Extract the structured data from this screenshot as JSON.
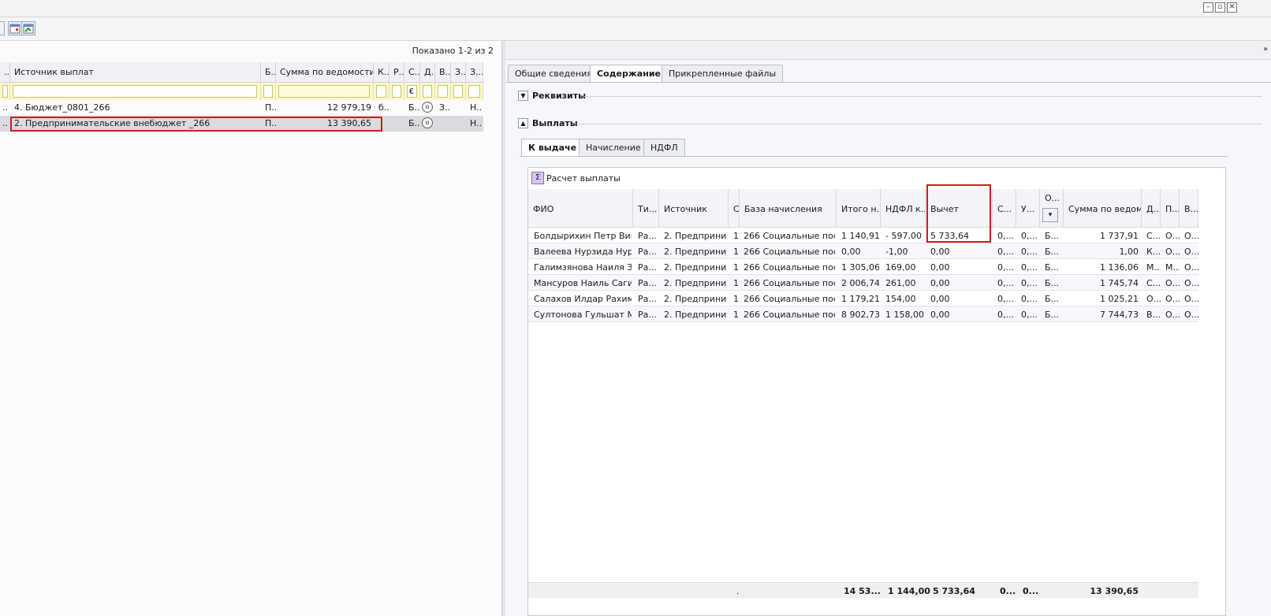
{
  "window": {
    "min_glyph": "–",
    "restore_glyph": "▫",
    "close_glyph": "✕"
  },
  "left": {
    "shown_text": "Показано 1-2 из 2",
    "columns": [
      "..",
      "Источник выплат",
      "Б...",
      "Сумма по ведомости",
      "К...",
      "Р...",
      "С...",
      "Д...",
      "В...",
      "З...",
      "З..."
    ],
    "filter_values": [
      "",
      "",
      "",
      "",
      "",
      "",
      "€",
      "",
      "",
      "",
      ""
    ],
    "rows": [
      {
        "c0": "..",
        "source": "4. Бюджет_0801_266",
        "b": "П...",
        "sum": "12 979,19",
        "k": "б...",
        "s": "Б...",
        "z1": "З...",
        "z2": "Н..."
      },
      {
        "c0": "..",
        "source": "2. Предпринимательские внебюджет _266",
        "b": "П...",
        "sum": "13 390,65",
        "k": "",
        "s": "Б...",
        "z1": "",
        "z2": "Н..."
      }
    ]
  },
  "right": {
    "tabs": [
      "Общие сведения",
      "Содержание",
      "Прикрепленные файлы"
    ],
    "section_requisites": "Реквизиты",
    "section_payments": "Выплаты",
    "subtabs": [
      "К выдаче",
      "Начисление",
      "НДФЛ"
    ],
    "calc_button": "Расчет выплаты",
    "columns": [
      "ФИО",
      "Ти...",
      "Источник",
      "С",
      "База начисления",
      "Итого н...",
      "НДФЛ к...",
      "Вычет",
      "С...",
      "У...",
      "О...",
      "Сумма по ведом...",
      "Д...",
      "П...",
      "В..."
    ],
    "rows": [
      [
        "Болдырихин Петр Вик...",
        "Ра...",
        "2. Предприни...",
        "1",
        "266 Социальные пос...",
        "1 140,91",
        "- 597,00",
        "5 733,64",
        "0,...",
        "0,...",
        "Б...",
        "1 737,91",
        "С...",
        "О...",
        "О..."
      ],
      [
        "Валеева Нурзида Нури...",
        "Ра...",
        "2. Предприни...",
        "1",
        "266 Социальные пос...",
        "0,00",
        "-1,00",
        "0,00",
        "0,...",
        "0,...",
        "Б...",
        "1,00",
        "К...",
        "О...",
        "О..."
      ],
      [
        "Галимзянова Наиля За...",
        "Ра...",
        "2. Предприни...",
        "1",
        "266 Социальные пос...",
        "1 305,06",
        "169,00",
        "0,00",
        "0,...",
        "0,...",
        "Б...",
        "1 136,06",
        "М...",
        "М...",
        "О..."
      ],
      [
        "Мансуров Наиль Сагит...",
        "Ра...",
        "2. Предприни...",
        "1",
        "266 Социальные пос...",
        "2 006,74",
        "261,00",
        "0,00",
        "0,...",
        "0,...",
        "Б...",
        "1 745,74",
        "С...",
        "О...",
        "О..."
      ],
      [
        "Салахов Илдар Рахимо...",
        "Ра...",
        "2. Предприни...",
        "1",
        "266 Социальные пос...",
        "1 179,21",
        "154,00",
        "0,00",
        "0,...",
        "0,...",
        "Б...",
        "1 025,21",
        "О...",
        "О...",
        "О..."
      ],
      [
        "Султонова Гульшат Ма...",
        "Ра...",
        "2. Предприни...",
        "1",
        "266 Социальные пос...",
        "8 902,73",
        "1 158,00",
        "0,00",
        "0,...",
        "0,...",
        "Б...",
        "7 744,73",
        "В...",
        "О...",
        "О..."
      ]
    ],
    "totals": {
      "dot": ".",
      "itogo": "14 53...",
      "ndfl": "1 144,00",
      "vychet": "5 733,64",
      "s": "0...",
      "u": "0...",
      "sum": "13 390,65"
    }
  }
}
